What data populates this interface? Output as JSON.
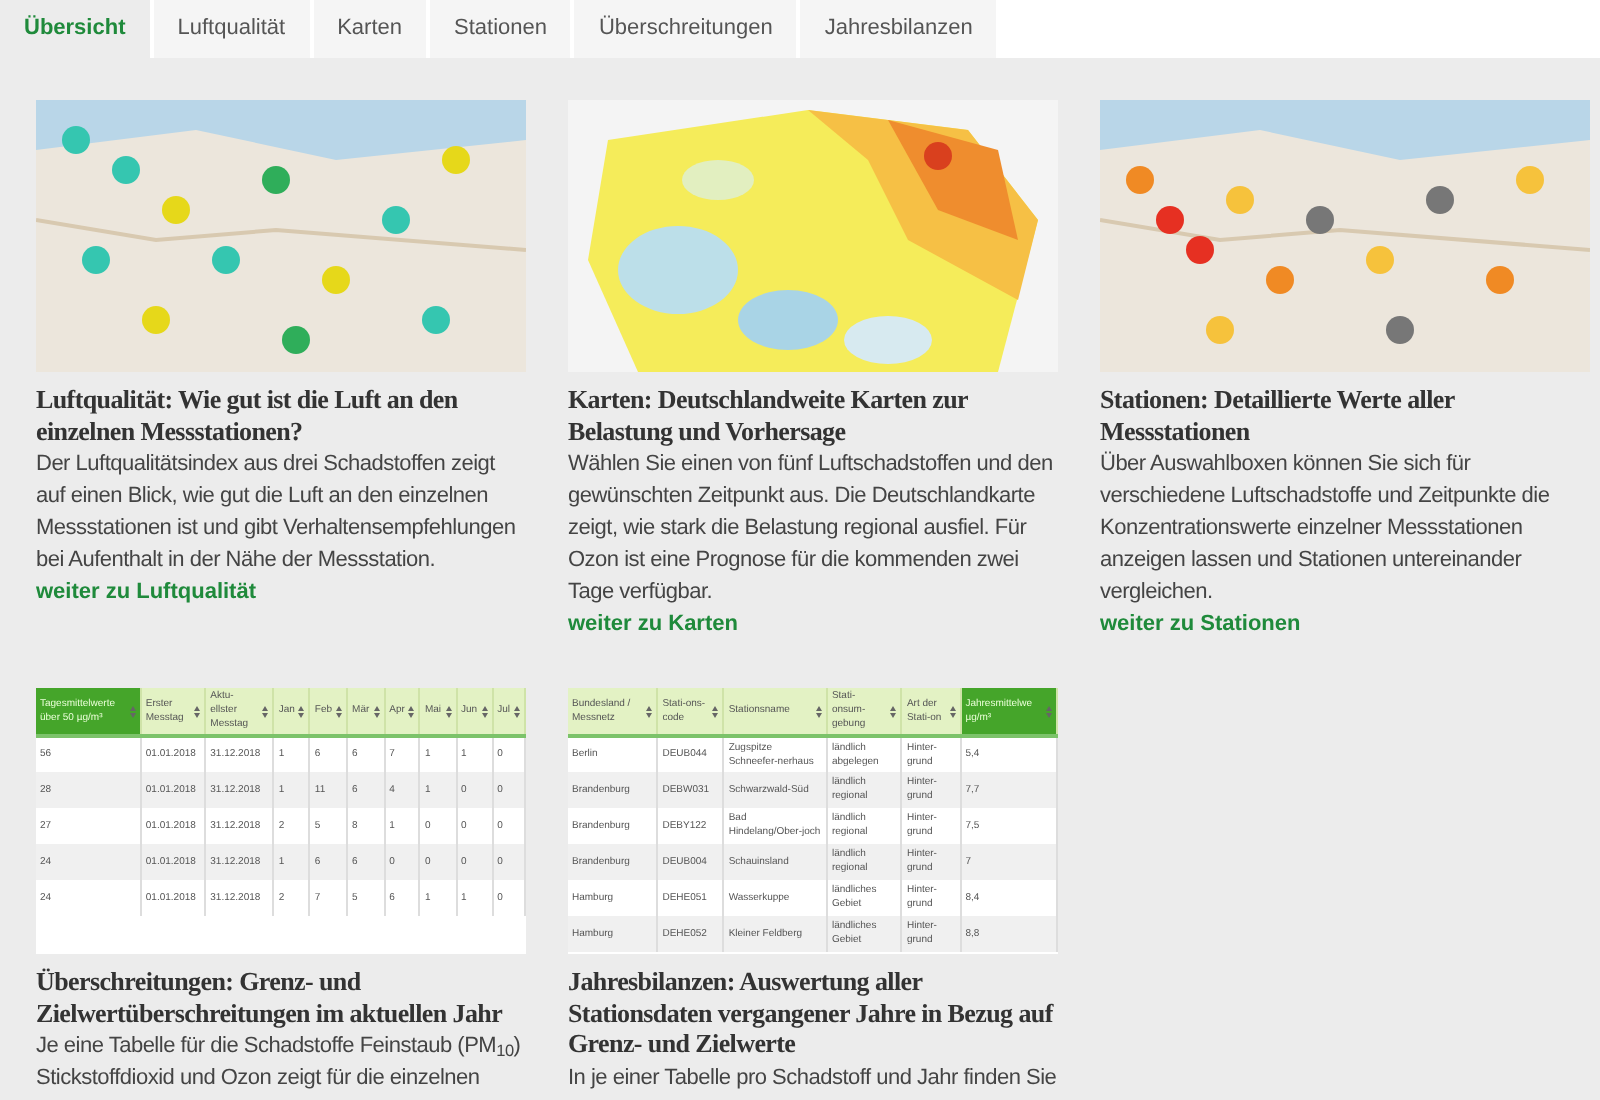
{
  "tabs": [
    {
      "label": "Übersicht",
      "selected": true
    },
    {
      "label": "Luftqualität",
      "selected": false
    },
    {
      "label": "Karten",
      "selected": false
    },
    {
      "label": "Stationen",
      "selected": false
    },
    {
      "label": "Überschreitungen",
      "selected": false
    },
    {
      "label": "Jahresbilanzen",
      "selected": false
    }
  ],
  "cards": [
    {
      "kind": "map",
      "title": "Luftqualität: Wie gut ist die Luft an den einzelnen Messstationen?",
      "text": "Der Luftqualitätsindex aus drei Schadstoffen zeigt auf einen Blick, wie gut die Luft an den einzelnen Messstationen ist und gibt Verhaltensempfehlungen bei Aufenthalt in der Nähe der Messstation.",
      "link": "weiter zu Luftqualität"
    },
    {
      "kind": "map",
      "title": "Karten: Deutschlandweite Karten zur Belastung und Vorhersage",
      "text": "Wählen Sie einen von fünf Luftschadstoffen und den gewünschten Zeitpunkt aus. Die Deutschlandkarte zeigt, wie stark die Belastung regional ausfiel. Für Ozon ist eine Prognose für die kommenden zwei Tage verfügbar.",
      "link": "weiter zu Karten"
    },
    {
      "kind": "map",
      "title": "Stationen: Detaillierte Werte aller Messstationen",
      "text": "Über Auswahlboxen können Sie sich für verschiedene Luftschadstoffe und Zeitpunkte die Konzentrationswerte einzelner Messstationen anzeigen lassen und Stationen untereinander vergleichen.",
      "link": "weiter zu Stationen"
    },
    {
      "kind": "table",
      "title": "Überschreitungen: Grenz- und Zielwertüberschreitungen im aktuellen Jahr",
      "text": "Je eine Tabelle für die Schadstoffe Feinstaub (PM$_{10}$) Stickstoffdioxid und Ozon zeigt für die einzelnen",
      "table": {
        "columns": [
          {
            "label": "Tagesmittelwerte über 50 µg/m³",
            "selected": true
          },
          {
            "label": "Erster Messtag",
            "selected": false
          },
          {
            "label": "Aktu-ellster Messtag",
            "selected": false
          },
          {
            "label": "Jan",
            "selected": false
          },
          {
            "label": "Feb",
            "selected": false
          },
          {
            "label": "Mär",
            "selected": false
          },
          {
            "label": "Apr",
            "selected": false
          },
          {
            "label": "Mai",
            "selected": false
          },
          {
            "label": "Jun",
            "selected": false
          },
          {
            "label": "Jul",
            "selected": false
          }
        ],
        "rows": [
          [
            "56",
            "01.01.2018",
            "31.12.2018",
            "1",
            "6",
            "6",
            "7",
            "1",
            "1",
            "0"
          ],
          [
            "28",
            "01.01.2018",
            "31.12.2018",
            "1",
            "11",
            "6",
            "4",
            "1",
            "0",
            "0"
          ],
          [
            "27",
            "01.01.2018",
            "31.12.2018",
            "2",
            "5",
            "8",
            "1",
            "0",
            "0",
            "0"
          ],
          [
            "24",
            "01.01.2018",
            "31.12.2018",
            "1",
            "6",
            "6",
            "0",
            "0",
            "0",
            "0"
          ],
          [
            "24",
            "01.01.2018",
            "31.12.2018",
            "2",
            "7",
            "5",
            "6",
            "1",
            "1",
            "0"
          ]
        ]
      }
    },
    {
      "kind": "table",
      "title": "Jahresbilanzen: Auswertung aller Stationsdaten vergangener Jahre in Bezug auf Grenz- und Zielwerte",
      "text": "In je einer Tabelle pro Schadstoff und Jahr finden Sie",
      "table": {
        "columns": [
          {
            "label": "Bundesland / Messnetz",
            "selected": false
          },
          {
            "label": "Stati-ons-code",
            "selected": false
          },
          {
            "label": "Stationsname",
            "selected": false
          },
          {
            "label": "Stati-onsum-gebung",
            "selected": false
          },
          {
            "label": "Art der Stati-on",
            "selected": false
          },
          {
            "label": "Jahresmittelwe µg/m³",
            "selected": true
          }
        ],
        "rows": [
          [
            "Berlin",
            "DEUB044",
            "Zugspitze Schneefer-nerhaus",
            "ländlich abgelegen",
            "Hinter-grund",
            "5,4"
          ],
          [
            "Brandenburg",
            "DEBW031",
            "Schwarzwald-Süd",
            "ländlich regional",
            "Hinter-grund",
            "7,7"
          ],
          [
            "Brandenburg",
            "DEBY122",
            "Bad Hindelang/Ober-joch",
            "ländlich regional",
            "Hinter-grund",
            "7,5"
          ],
          [
            "Brandenburg",
            "DEUB004",
            "Schauinsland",
            "ländlich regional",
            "Hinter-grund",
            "7"
          ],
          [
            "Hamburg",
            "DEHE051",
            "Wasserkuppe",
            "ländliches Gebiet",
            "Hinter-grund",
            "8,4"
          ],
          [
            "Hamburg",
            "DEHE052",
            "Kleiner Feldberg",
            "ländliches Gebiet",
            "Hinter-grund",
            "8,8"
          ]
        ]
      }
    }
  ]
}
